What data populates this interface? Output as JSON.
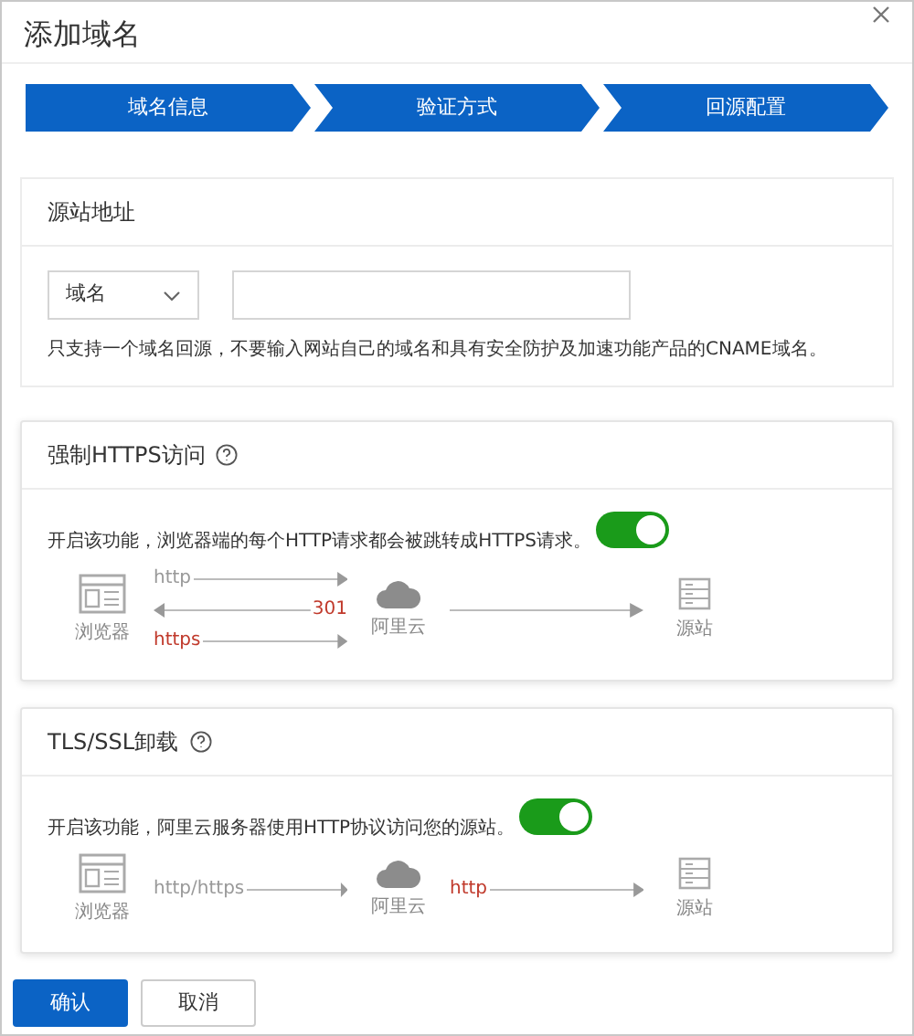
{
  "dialog": {
    "title": "添加域名"
  },
  "steps": [
    {
      "label": "域名信息",
      "active": true
    },
    {
      "label": "验证方式",
      "active": true
    },
    {
      "label": "回源配置",
      "active": true
    }
  ],
  "origin": {
    "title": "源站地址",
    "type_select": "域名",
    "note": "只支持一个域名回源，不要输入网站自己的域名和具有安全防护及加速功能产品的CNAME域名。"
  },
  "features": [
    {
      "title": "强制HTTPS访问",
      "description": "开启该功能，浏览器端的每个HTTP请求都会被跳转成HTTPS请求。",
      "on": true,
      "nodes": [
        "浏览器",
        "阿里云",
        "源站"
      ],
      "links": [
        [
          {
            "text": "http",
            "kind": "forward",
            "color": "#999999"
          },
          {
            "text": "301",
            "kind": "back",
            "color": "#c0392b"
          },
          {
            "text": "https",
            "kind": "forward",
            "color": "#c0392b"
          }
        ],
        [
          {
            "kind": "forward"
          }
        ]
      ]
    },
    {
      "title": "TLS/SSL卸载",
      "description": "开启该功能，阿里云服务器使用HTTP协议访问您的源站。",
      "on": true,
      "nodes": [
        "浏览器",
        "阿里云",
        "源站"
      ],
      "links": [
        [
          {
            "text": "http/https",
            "kind": "forward",
            "color": "#999999"
          }
        ],
        [
          {
            "text": "http",
            "kind": "forward",
            "color": "#c0392b"
          }
        ]
      ]
    }
  ],
  "buttons": {
    "confirm": "确认",
    "cancel": "取消"
  }
}
